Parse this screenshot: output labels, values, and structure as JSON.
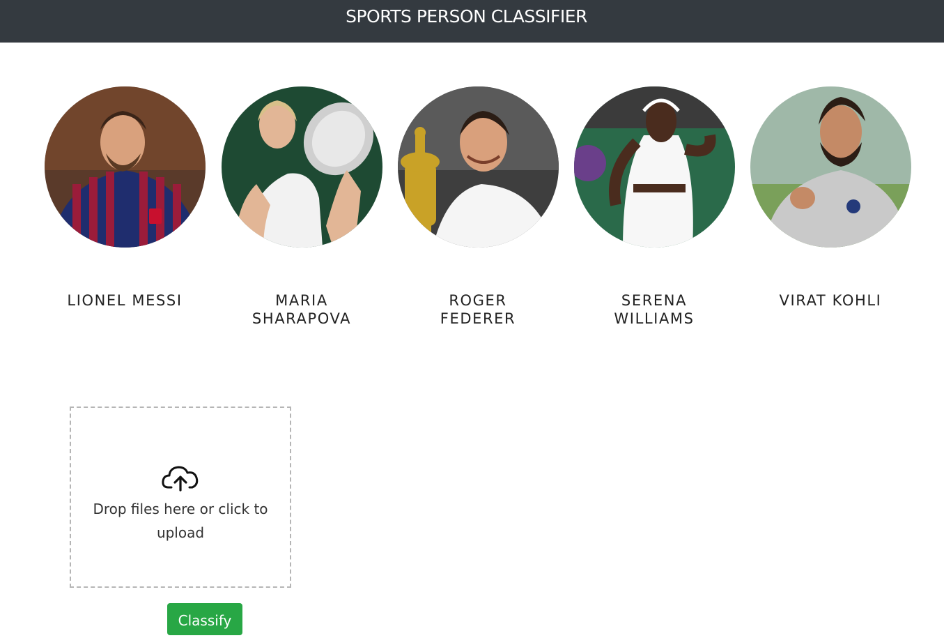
{
  "header": {
    "title": "SPORTS PERSON CLASSIFIER"
  },
  "players": [
    {
      "name": "LIONEL MESSI",
      "icon": "messi-photo"
    },
    {
      "name": "MARIA SHARAPOVA",
      "icon": "sharapova-photo"
    },
    {
      "name": "ROGER FEDERER",
      "icon": "federer-photo"
    },
    {
      "name": "SERENA WILLIAMS",
      "icon": "williams-photo"
    },
    {
      "name": "VIRAT KOHLI",
      "icon": "kohli-photo"
    }
  ],
  "upload": {
    "text": "Drop files here or click to upload",
    "icon": "cloud-upload-icon"
  },
  "actions": {
    "classify_label": "Classify",
    "classify_color": "#28a745"
  },
  "colors": {
    "navbar": "#343a40"
  }
}
